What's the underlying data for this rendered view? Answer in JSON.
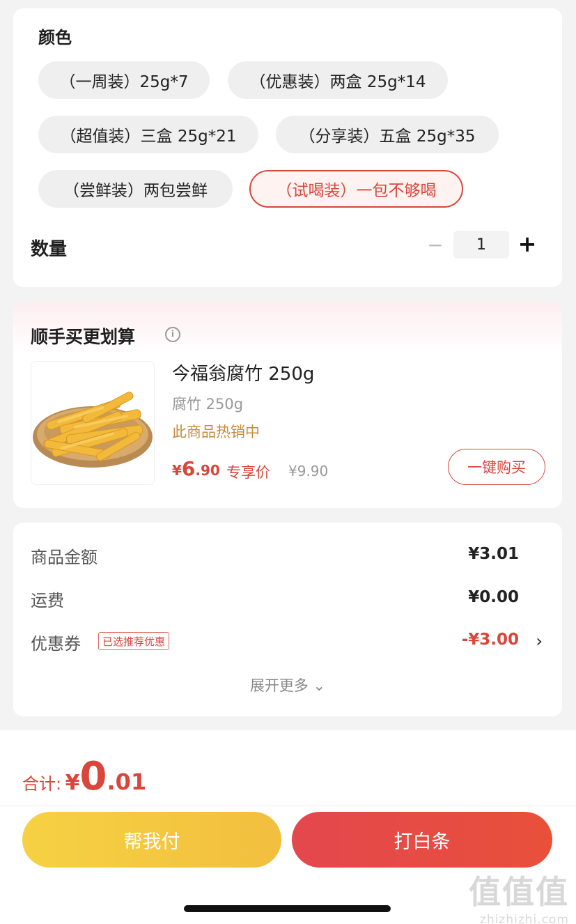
{
  "spec": {
    "color_label": "颜色",
    "options": [
      "（一周装）25g*7",
      "（优惠装）两盒 25g*14",
      "（超值装）三盒 25g*21",
      "（分享装）五盒 25g*35",
      "（尝鲜装）两包尝鲜",
      "（试喝装）一包不够喝"
    ],
    "selected_option": "（试喝装）一包不够喝",
    "quantity_label": "数量",
    "minus_icon": "−",
    "quantity": "1",
    "plus_icon": "+"
  },
  "upsell": {
    "title": "顺手买更划算",
    "info_icon": "i",
    "product": {
      "name": "今福翁腐竹 250g",
      "spec": "腐竹 250g",
      "hot": "此商品热销中",
      "price_currency": "¥",
      "price_int": "6",
      "price_dec": ".90",
      "price_label": "专享价",
      "original_price": "¥9.90",
      "buy_label": "一键购买"
    }
  },
  "summary": {
    "goods_label": "商品金额",
    "goods_value": "¥3.01",
    "shipping_label": "运费",
    "shipping_value": "¥0.00",
    "coupon_label": "优惠券",
    "coupon_tag": "已选推荐优惠",
    "coupon_value": "-¥3.00",
    "coupon_chevron": "›",
    "expand_label": "展开更多",
    "expand_chevron": "⌄"
  },
  "footer": {
    "total_label": "合计:",
    "total_currency": "¥",
    "total_int": "0",
    "total_dec": ".01",
    "pay_for_me": "帮我付",
    "baitiao": "打白条"
  },
  "watermark": {
    "big": "值值值",
    "small": "zhizhizhi.com"
  },
  "colors": {
    "accent": "#d9463b",
    "pay_button": "#f3c840",
    "baitiao_button": "#e6493f",
    "hot_text": "#c98a3c"
  }
}
